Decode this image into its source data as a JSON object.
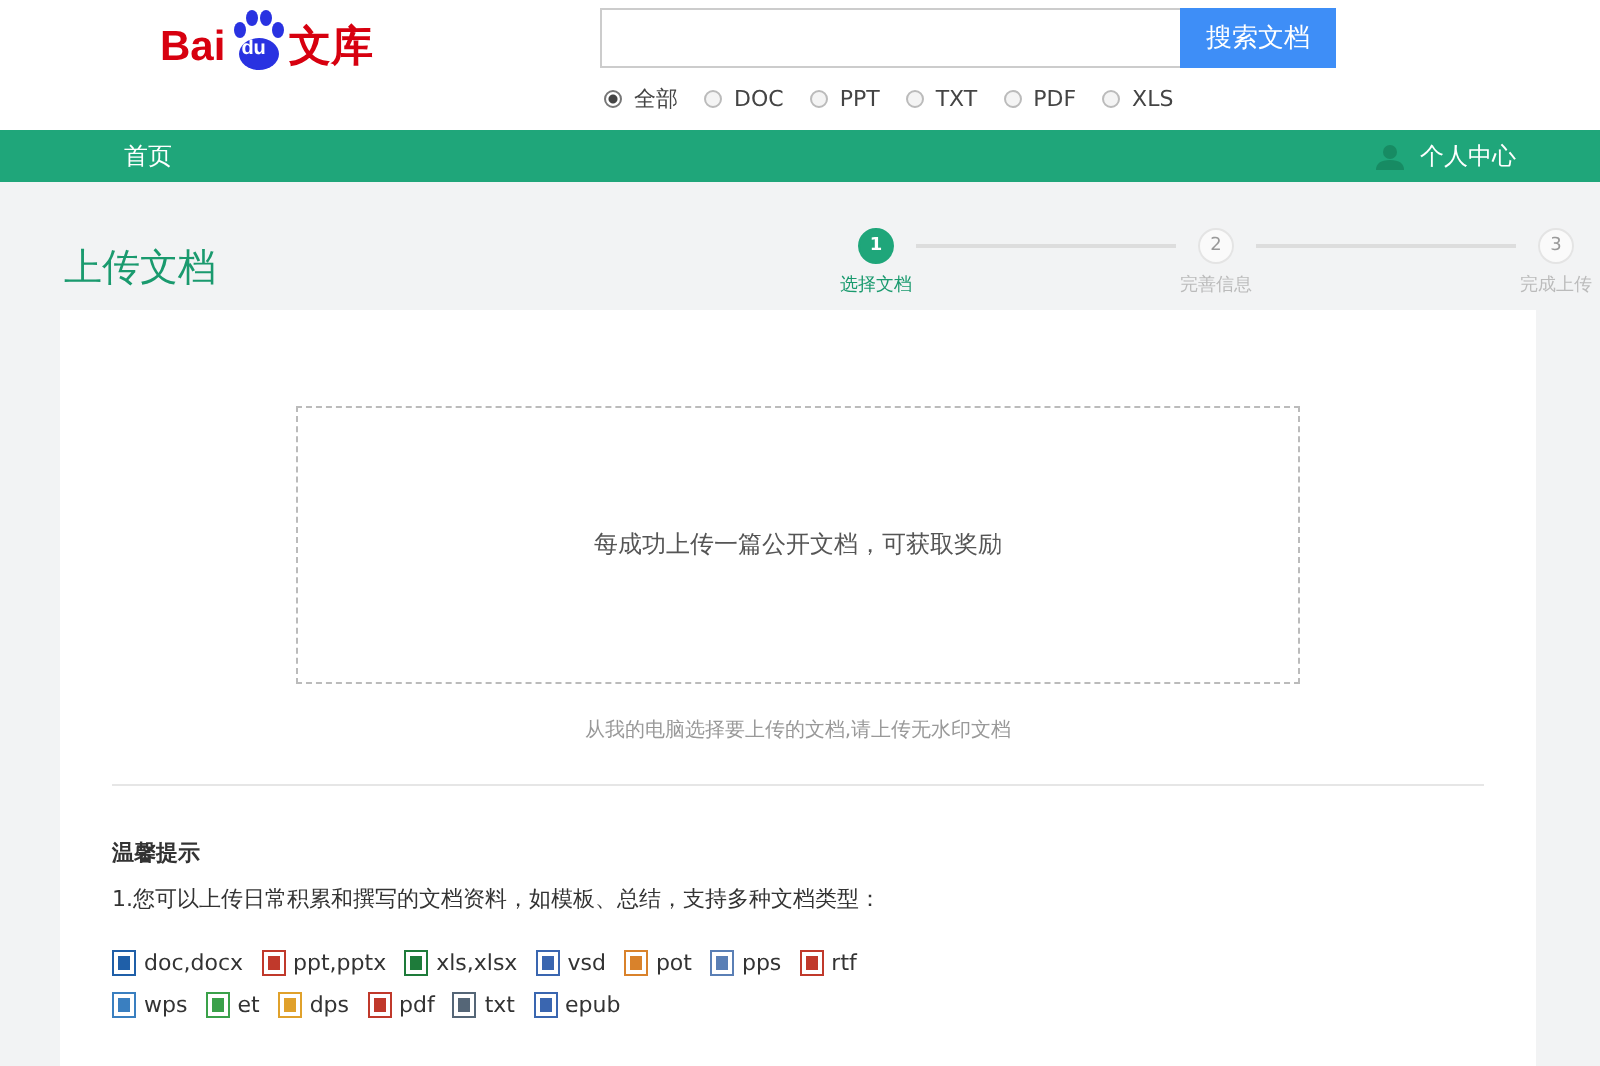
{
  "logo": {
    "part_1": "Bai",
    "part_2": "du",
    "part_3": "文库"
  },
  "search": {
    "button": "搜索文档"
  },
  "filters": [
    {
      "label": "全部",
      "selected": true
    },
    {
      "label": "DOC",
      "selected": false
    },
    {
      "label": "PPT",
      "selected": false
    },
    {
      "label": "TXT",
      "selected": false
    },
    {
      "label": "PDF",
      "selected": false
    },
    {
      "label": "XLS",
      "selected": false
    }
  ],
  "nav": {
    "home": "首页",
    "user": "个人中心"
  },
  "page_title": "上传文档",
  "steps": [
    {
      "number": "1",
      "label": "选择文档",
      "active": true
    },
    {
      "number": "2",
      "label": "完善信息",
      "active": false
    },
    {
      "number": "3",
      "label": "完成上传",
      "active": false
    }
  ],
  "upload": {
    "prompt": "每成功上传一篇公开文档，可获取奖励",
    "caption": "从我的电脑选择要上传的文档,请上传无水印文档"
  },
  "tips": {
    "heading": "温馨提示",
    "line_1": "1.您可以上传日常积累和撰写的文档资料，如模板、总结，支持多种文档类型：",
    "file_types": [
      [
        {
          "label": "doc,docx",
          "color": "#1f5fa8"
        },
        {
          "label": "ppt,pptx",
          "color": "#c0392b"
        },
        {
          "label": "xls,xlsx",
          "color": "#1e7b3a"
        },
        {
          "label": "vsd",
          "color": "#3a66b0"
        },
        {
          "label": "pot",
          "color": "#d9822b"
        },
        {
          "label": "pps",
          "color": "#5a7fb5"
        },
        {
          "label": "rtf",
          "color": "#c0392b"
        }
      ],
      [
        {
          "label": "wps",
          "color": "#3a7fc0"
        },
        {
          "label": "et",
          "color": "#3aa14a"
        },
        {
          "label": "dps",
          "color": "#e0a12b"
        },
        {
          "label": "pdf",
          "color": "#c0392b"
        },
        {
          "label": "txt",
          "color": "#556677"
        },
        {
          "label": "epub",
          "color": "#3a66b0"
        }
      ]
    ]
  }
}
